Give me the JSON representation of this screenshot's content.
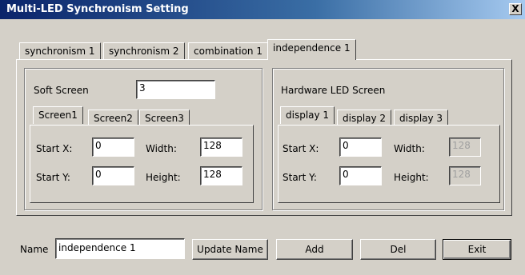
{
  "window": {
    "title": "Multi-LED Synchronism Setting",
    "close_label": "X"
  },
  "main_tabs": [
    {
      "label": "synchronism 1"
    },
    {
      "label": "synchronism 2"
    },
    {
      "label": "combination 1"
    },
    {
      "label": "independence 1"
    }
  ],
  "soft_screen": {
    "label": "Soft Screen",
    "value": "3",
    "tabs": [
      {
        "label": "Screen1"
      },
      {
        "label": "Screen2"
      },
      {
        "label": "Screen3"
      }
    ],
    "start_x_label": "Start X:",
    "start_x": "0",
    "start_y_label": "Start Y:",
    "start_y": "0",
    "width_label": "Width:",
    "width": "128",
    "height_label": "Height:",
    "height": "128"
  },
  "hardware_screen": {
    "label": "Hardware LED Screen",
    "tabs": [
      {
        "label": "display 1"
      },
      {
        "label": "display 2"
      },
      {
        "label": "display 3"
      }
    ],
    "start_x_label": "Start X:",
    "start_x": "0",
    "start_y_label": "Start Y:",
    "start_y": "0",
    "width_label": "Width:",
    "width": "128",
    "height_label": "Height:",
    "height": "128"
  },
  "footer": {
    "name_label": "Name",
    "name_value": "independence 1",
    "update_name_label": "Update Name",
    "add_label": "Add",
    "del_label": "Del",
    "exit_label": "Exit"
  }
}
